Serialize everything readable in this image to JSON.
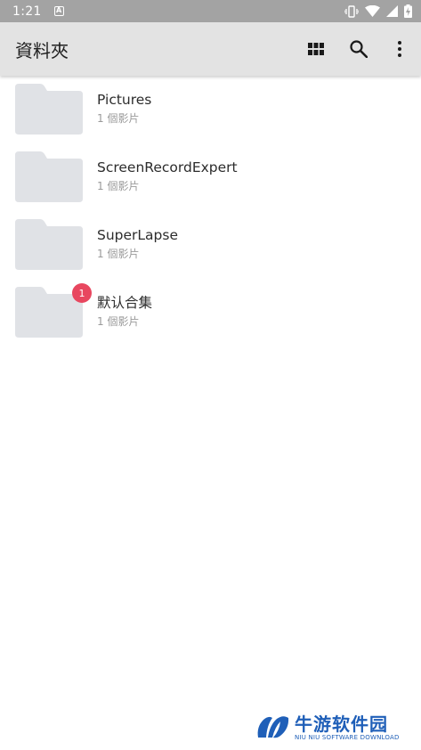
{
  "status_bar": {
    "time": "1:21",
    "notification_icon": "a-letter-icon",
    "icons": [
      "vibrate-icon",
      "wifi-icon",
      "signal-icon",
      "battery-charging-icon"
    ]
  },
  "app_bar": {
    "title": "資料夾",
    "actions": [
      "grid-view-icon",
      "search-icon",
      "more-vert-icon"
    ]
  },
  "folders": [
    {
      "name": "Pictures",
      "count": "1 個影片"
    },
    {
      "name": "ScreenRecordExpert",
      "count": "1 個影片"
    },
    {
      "name": "SuperLapse",
      "count": "1 個影片"
    },
    {
      "name": "默认合集",
      "count": "1 個影片",
      "badge": "1"
    }
  ],
  "watermark": {
    "title": "牛游软件园",
    "subtitle": "NIU NIU SOFTWARE DOWNLOAD"
  },
  "colors": {
    "status_bar": "#a3a3a3",
    "app_bar": "#e3e3e3",
    "folder": "#e0e2e6",
    "badge": "#e8475f",
    "watermark": "#1f5fb8"
  }
}
